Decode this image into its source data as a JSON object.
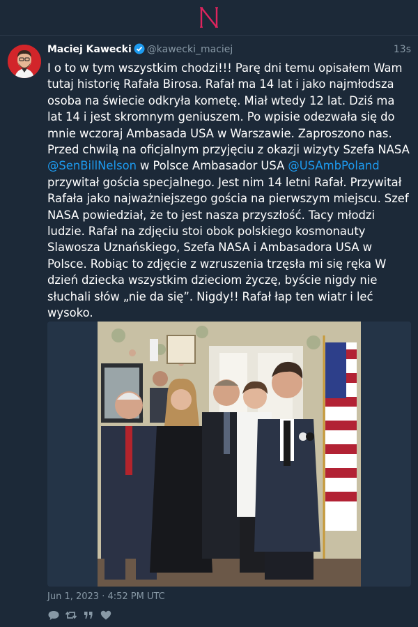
{
  "app": {
    "logo_letter": "N"
  },
  "tweet": {
    "author_name": "Maciej Kawecki",
    "author_handle": "@kawecki_maciej",
    "time_ago": "13s",
    "text_parts": [
      "I o to w tym wszystkim chodzi!!! Parę dni temu opisałem Wam tutaj historię Rafała Birosa. Rafał ma 14 lat i jako najmłodsza osoba na świecie odkryła kometę. Miał wtedy 12 lat. Dziś ma lat 14 i jest skromnym geniuszem. Po wpisie odezwała się do mnie wczoraj Ambasada USA w Warszawie. Zaproszono nas. Przed chwilą na oficjalnym przyjęciu z okazji wizyty Szefa NASA ",
      "@SenBillNelson",
      " w Polsce Ambasador USA ",
      "@USAmbPoland",
      " przywitał gościa specjalnego. Jest nim 14 letni Rafał. Przywitał Rafała jako najważniejszego gościa na pierwszym miejscu. Szef NASA powiedział, że to jest nasza przyszłość. Tacy młodzi ludzie. Rafał na zdjęciu stoi obok polskiego kosmonauty Slawosza Uznańskiego, Szefa NASA i Ambasadora USA w Polsce. Robiąc to zdjęcie z wzruszenia trzęsła mi się ręka    W dzień dziecka wszystkim dzieciom życzę, byście nigdy nie słuchali słów „nie da się”. Nigdy!! Rafał łap ten wiatr i leć wysoko."
    ],
    "timestamp": "Jun 1, 2023 · 4:52 PM UTC"
  },
  "colors": {
    "background": "#1c2938",
    "accent": "#1d9bf0",
    "logo": "#e0245e",
    "muted": "#8899a6"
  },
  "icons": [
    "reply-icon",
    "retweet-icon",
    "quote-icon",
    "like-icon"
  ]
}
